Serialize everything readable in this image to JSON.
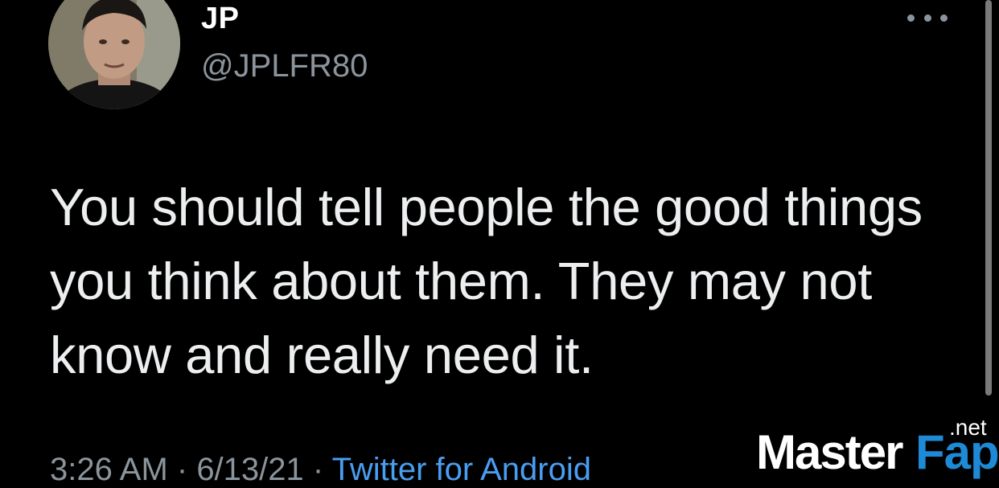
{
  "author": {
    "name": "JP",
    "handle": "@JPLFR80"
  },
  "tweet": {
    "text": "You should tell people the good things you think about them. They may not know and really need it.",
    "time": "3:26 AM",
    "date": "6/13/21",
    "separator": " · ",
    "source": "Twitter for Android"
  },
  "watermark": {
    "part1": "Master",
    "part2": "Fap",
    "suffix": ".net"
  },
  "icons": {
    "more": "more-horizontal-icon",
    "avatar": "profile-photo"
  },
  "colors": {
    "background": "#000000",
    "link": "#4a9df0",
    "muted": "#8b949c"
  }
}
